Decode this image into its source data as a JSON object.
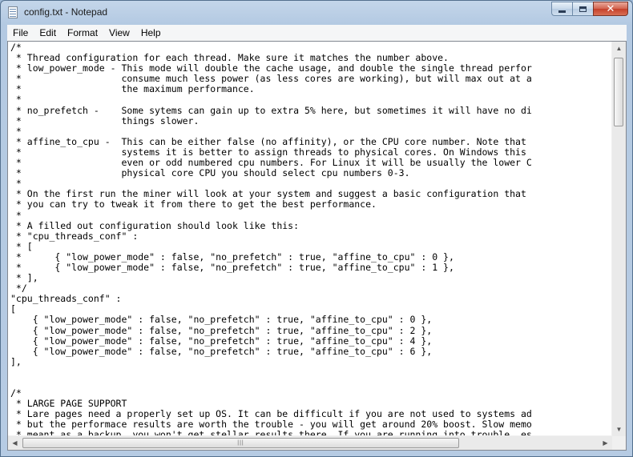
{
  "window": {
    "title": "config.txt - Notepad"
  },
  "caption_buttons": {
    "minimize_icon": "minimize-icon",
    "maximize_icon": "maximize-icon",
    "close_icon": "close-icon",
    "close_glyph": "✕"
  },
  "menu": {
    "items": [
      "File",
      "Edit",
      "Format",
      "View",
      "Help"
    ]
  },
  "editor": {
    "lines": [
      "/*",
      " * Thread configuration for each thread. Make sure it matches the number above.",
      " * low_power_mode - This mode will double the cache usage, and double the single thread perfor",
      " *                  consume much less power (as less cores are working), but will max out at a",
      " *                  the maximum performance.",
      " *",
      " * no_prefetch -    Some sytems can gain up to extra 5% here, but sometimes it will have no di",
      " *                  things slower.",
      " *",
      " * affine_to_cpu -  This can be either false (no affinity), or the CPU core number. Note that",
      " *                  systems it is better to assign threads to physical cores. On Windows this",
      " *                  even or odd numbered cpu numbers. For Linux it will be usually the lower C",
      " *                  physical core CPU you should select cpu numbers 0-3.",
      " *",
      " * On the first run the miner will look at your system and suggest a basic configuration that",
      " * you can try to tweak it from there to get the best performance.",
      " *",
      " * A filled out configuration should look like this:",
      " * \"cpu_threads_conf\" :",
      " * [",
      " *      { \"low_power_mode\" : false, \"no_prefetch\" : true, \"affine_to_cpu\" : 0 },",
      " *      { \"low_power_mode\" : false, \"no_prefetch\" : true, \"affine_to_cpu\" : 1 },",
      " * ],",
      " */",
      "\"cpu_threads_conf\" :",
      "[",
      "    { \"low_power_mode\" : false, \"no_prefetch\" : true, \"affine_to_cpu\" : 0 },",
      "    { \"low_power_mode\" : false, \"no_prefetch\" : true, \"affine_to_cpu\" : 2 },",
      "    { \"low_power_mode\" : false, \"no_prefetch\" : true, \"affine_to_cpu\" : 4 },",
      "    { \"low_power_mode\" : false, \"no_prefetch\" : true, \"affine_to_cpu\" : 6 },",
      "],",
      "",
      "",
      "/*",
      " * LARGE PAGE SUPPORT",
      " * Lare pages need a properly set up OS. It can be difficult if you are not used to systems ad",
      " * but the performace results are worth the trouble - you will get around 20% boost. Slow memo",
      " * meant as a backup, you won't get stellar results there. If you are running into trouble, es"
    ]
  },
  "scrollbars": {
    "up_arrow": "▲",
    "down_arrow": "▼",
    "left_arrow": "◀",
    "right_arrow": "▶",
    "grip": "|||"
  }
}
